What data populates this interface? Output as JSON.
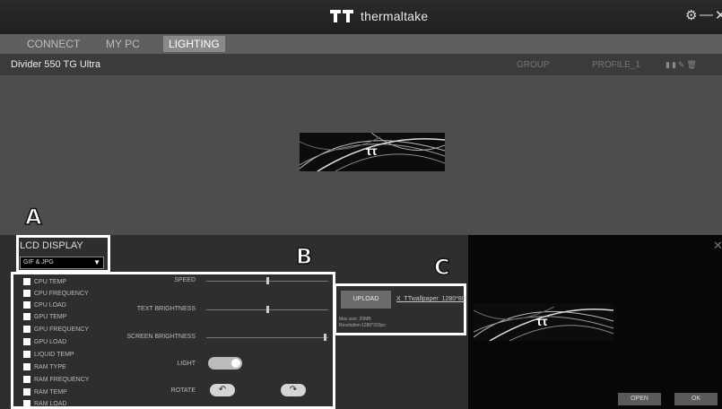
{
  "app": {
    "brand": "thermaltake",
    "settings_icon": "gear-icon",
    "minimize_icon": "minimize-icon",
    "close_icon": "close-icon"
  },
  "nav": {
    "tabs": [
      {
        "label": "CONNECT"
      },
      {
        "label": "MY PC"
      },
      {
        "label": "LIGHTING"
      }
    ],
    "active": "LIGHTING"
  },
  "device": {
    "name": "Divider 550 TG Ultra",
    "group": "GROUP",
    "profile": "PROFILE_1"
  },
  "annotations": {
    "a": "A",
    "b": "B",
    "c": "C"
  },
  "lcd": {
    "title": "LCD DISPLAY",
    "mode": "GIF & JPG"
  },
  "sensors": [
    "CPU TEMP",
    "CPU FREQUENCY",
    "CPU LOAD",
    "GPU TEMP",
    "GPU FREQUENCY",
    "GPU LOAD",
    "LIQUID TEMP",
    "RAM TYPE",
    "RAM FREQUENCY",
    "RAM TEMP",
    "RAM LOAD"
  ],
  "controls": {
    "speed": "SPEED",
    "text_brightness": "TEXT BRIGHTNESS",
    "screen_brightness": "SCREEN BRIGHTNESS",
    "light": "LIGHT",
    "rotate": "ROTATE"
  },
  "upload": {
    "button": "UPLOAD",
    "file": "X_TTwallpaper_1280*80",
    "max_size": "Max size: 20MB",
    "resolution": "Resolution:1280*320px"
  },
  "dialog": {
    "open": "OPEN",
    "ok": "OK"
  },
  "colors": {
    "titlebar": "#232323",
    "nav_active": "#8a8a8a",
    "panel_bg": "#2e2e2e",
    "highlight_box": "#ffffff"
  }
}
